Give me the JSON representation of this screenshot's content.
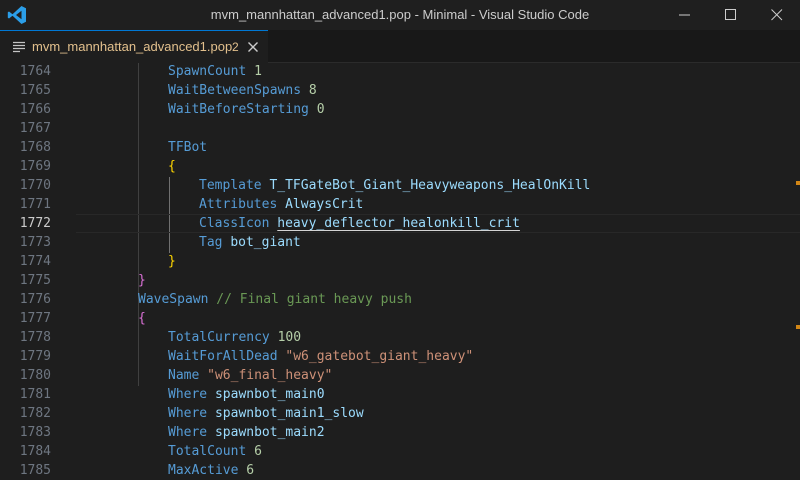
{
  "window": {
    "title": "mvm_mannhattan_advanced1.pop - Minimal - Visual Studio Code",
    "icons": [
      "vscode-logo-icon",
      "minimize-icon",
      "maximize-icon",
      "close-icon"
    ]
  },
  "tab": {
    "label": "mvm_mannhattan_advanced1.pop",
    "badge": "2",
    "icon": "file-lines-icon",
    "label_color": "#e2c08d"
  },
  "editor": {
    "current_line": "1772",
    "lines": [
      {
        "num": "1764",
        "parts": [
          [
            "k",
            "SpawnCount"
          ],
          [
            "n",
            " 1"
          ]
        ]
      },
      {
        "num": "1765",
        "parts": [
          [
            "k",
            "WaitBetweenSpawns"
          ],
          [
            "n",
            " 8"
          ]
        ]
      },
      {
        "num": "1766",
        "parts": [
          [
            "k",
            "WaitBeforeStarting"
          ],
          [
            "n",
            " 0"
          ]
        ]
      },
      {
        "num": "1767",
        "parts": []
      },
      {
        "num": "1768",
        "parts": [
          [
            "k",
            "TFBot"
          ]
        ]
      },
      {
        "num": "1769",
        "parts": [
          [
            "br",
            "{"
          ]
        ]
      },
      {
        "num": "1770",
        "parts": [
          [
            "k",
            "Template"
          ],
          [
            "t",
            " "
          ],
          [
            "v",
            "T_TFGateBot_Giant_Heavyweapons_HealOnKill"
          ]
        ]
      },
      {
        "num": "1771",
        "parts": [
          [
            "k",
            "Attributes"
          ],
          [
            "t",
            " "
          ],
          [
            "v",
            "AlwaysCrit"
          ]
        ]
      },
      {
        "num": "1772",
        "parts": [
          [
            "k",
            "ClassIcon"
          ],
          [
            "t",
            " "
          ],
          [
            "vu",
            "heavy_deflector_healonkill_crit"
          ]
        ]
      },
      {
        "num": "1773",
        "parts": [
          [
            "k",
            "Tag"
          ],
          [
            "t",
            " "
          ],
          [
            "v",
            "bot_giant"
          ]
        ]
      },
      {
        "num": "1774",
        "parts": [
          [
            "br",
            "}"
          ]
        ]
      },
      {
        "num": "1775",
        "parts": [
          [
            "br2",
            "}"
          ]
        ]
      },
      {
        "num": "1776",
        "parts": [
          [
            "k",
            "WaveSpawn"
          ],
          [
            "t",
            " "
          ],
          [
            "c",
            "// Final giant heavy push"
          ]
        ]
      },
      {
        "num": "1777",
        "parts": [
          [
            "br2",
            "{"
          ]
        ]
      },
      {
        "num": "1778",
        "parts": [
          [
            "k",
            "TotalCurrency"
          ],
          [
            "n",
            " 100"
          ]
        ]
      },
      {
        "num": "1779",
        "parts": [
          [
            "k",
            "WaitForAllDead"
          ],
          [
            "t",
            " "
          ],
          [
            "s",
            "\"w6_gatebot_giant_heavy\""
          ]
        ]
      },
      {
        "num": "1780",
        "parts": [
          [
            "k",
            "Name"
          ],
          [
            "t",
            " "
          ],
          [
            "s",
            "\"w6_final_heavy\""
          ]
        ]
      },
      {
        "num": "1781",
        "parts": [
          [
            "k",
            "Where"
          ],
          [
            "t",
            " "
          ],
          [
            "v",
            "spawnbot_main0"
          ]
        ]
      },
      {
        "num": "1782",
        "parts": [
          [
            "k",
            "Where"
          ],
          [
            "t",
            " "
          ],
          [
            "v",
            "spawnbot_main1_slow"
          ]
        ]
      },
      {
        "num": "1783",
        "parts": [
          [
            "k",
            "Where"
          ],
          [
            "t",
            " "
          ],
          [
            "v",
            "spawnbot_main2"
          ]
        ]
      },
      {
        "num": "1784",
        "parts": [
          [
            "k",
            "TotalCount"
          ],
          [
            "n",
            " 6"
          ]
        ]
      },
      {
        "num": "1785",
        "parts": [
          [
            "k",
            "MaxActive"
          ],
          [
            "n",
            " 6"
          ]
        ]
      }
    ]
  },
  "colors": {
    "keyword": "#569cd6",
    "identifier": "#9cdcfe",
    "number": "#b5cea8",
    "string": "#ce9178",
    "comment": "#6a9955",
    "bracket_yellow": "#ffd700",
    "bracket_purple": "#da70d6",
    "accent": "#0078d4"
  }
}
